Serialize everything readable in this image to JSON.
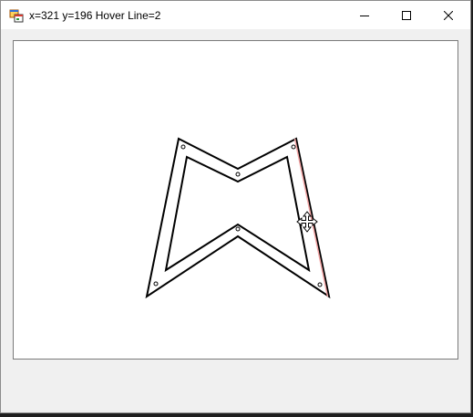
{
  "window": {
    "title": "x=321 y=196 Hover Line=2"
  },
  "titlebar": {
    "app_icon": "windows-forms-app-icon",
    "buttons": {
      "minimize": "minimize-icon",
      "maximize": "maximize-icon",
      "close": "close-icon"
    }
  },
  "cursor": {
    "icon": "move-cursor-icon"
  },
  "colors": {
    "shape_stroke": "#000000",
    "hover_highlight": "#f4a6a6",
    "canvas_background": "#ffffff",
    "client_background": "#f0f0f0"
  }
}
